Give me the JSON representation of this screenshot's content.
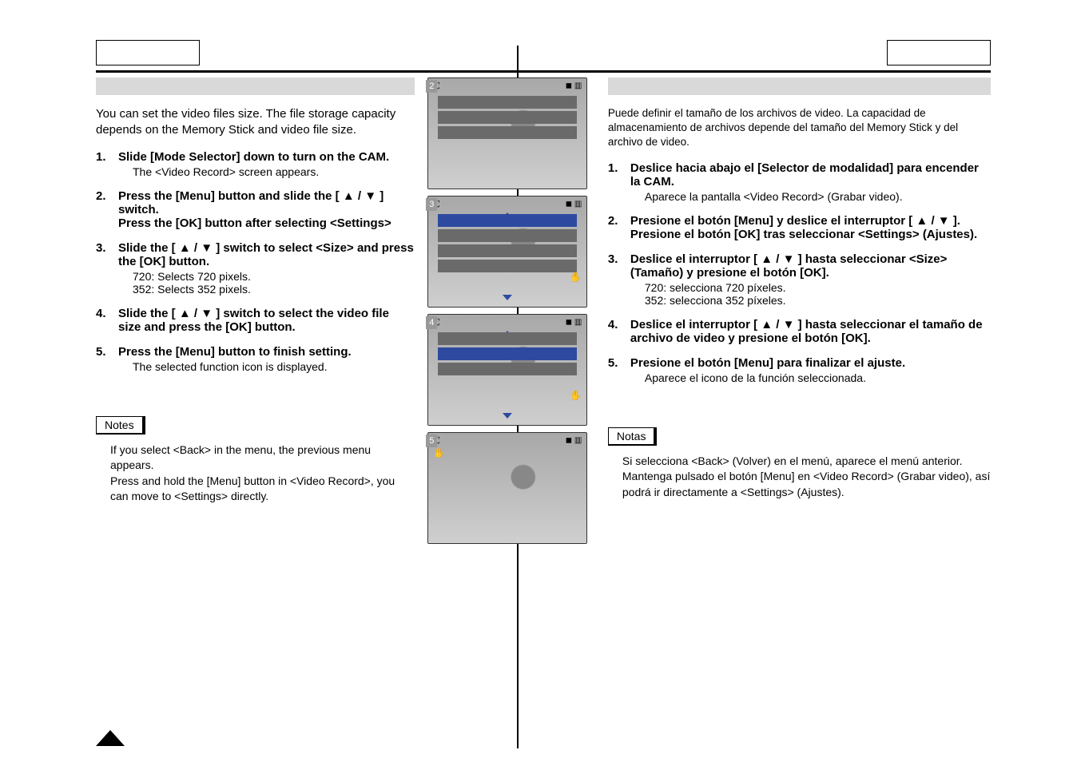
{
  "left": {
    "intro": "You can set the video files size. The file storage capacity depends on the Memory Stick and video file size.",
    "steps": [
      {
        "num": "1.",
        "bold": "Slide [Mode Selector] down to turn on the CAM.",
        "sub": "The <Video Record> screen appears."
      },
      {
        "num": "2.",
        "bold": "Press the [Menu] button and slide the [ ▲ / ▼ ] switch.\nPress the [OK] button after selecting <Settings>",
        "sub": ""
      },
      {
        "num": "3.",
        "bold": "Slide the [ ▲ / ▼ ] switch to select <Size> and press the [OK] button.",
        "sub": "720: Selects 720 pixels.\n352: Selects 352 pixels."
      },
      {
        "num": "4.",
        "bold": "Slide the [ ▲ / ▼ ] switch to select the video file size and press the [OK] button.",
        "sub": ""
      },
      {
        "num": "5.",
        "bold": "Press the [Menu] button to finish setting.",
        "sub": "The selected function icon is displayed."
      }
    ],
    "notes_label": "Notes",
    "notes": "If you select <Back> in the menu, the previous menu appears.\nPress and hold the [Menu] button in <Video Record>, you can move to <Settings> directly."
  },
  "right": {
    "intro": "Puede definir el tamaño de los archivos de video. La capacidad de almacenamiento de archivos depende del tamaño del Memory Stick y del archivo de video.",
    "steps": [
      {
        "num": "1.",
        "bold": "Deslice hacia abajo el [Selector de modalidad] para encender la CAM.",
        "sub": "Aparece la pantalla <Video Record> (Grabar video)."
      },
      {
        "num": "2.",
        "bold": "Presione el botón [Menu] y deslice el interruptor [ ▲ / ▼ ].\nPresione el botón [OK] tras seleccionar <Settings> (Ajustes).",
        "sub": ""
      },
      {
        "num": "3.",
        "bold": "Deslice el interruptor [ ▲ / ▼ ] hasta seleccionar <Size> (Tamaño) y presione el botón [OK].",
        "sub": "720: selecciona 720 píxeles.\n352: selecciona 352 píxeles."
      },
      {
        "num": "4.",
        "bold": "Deslice el interruptor [ ▲ / ▼ ] hasta seleccionar el tamaño de archivo de video y presione el botón [OK].",
        "sub": ""
      },
      {
        "num": "5.",
        "bold": "Presione el botón [Menu] para finalizar el ajuste.",
        "sub": "Aparece el icono de la función seleccionada."
      }
    ],
    "notes_label": "Notas",
    "notes": "Si selecciona <Back> (Volver) en el menú, aparece el menú anterior.\nMantenga pulsado el botón [Menu] en <Video Record> (Grabar video), así podrá ir directamente a <Settings> (Ajustes)."
  },
  "thumbs": [
    "2",
    "3",
    "4",
    "5"
  ]
}
